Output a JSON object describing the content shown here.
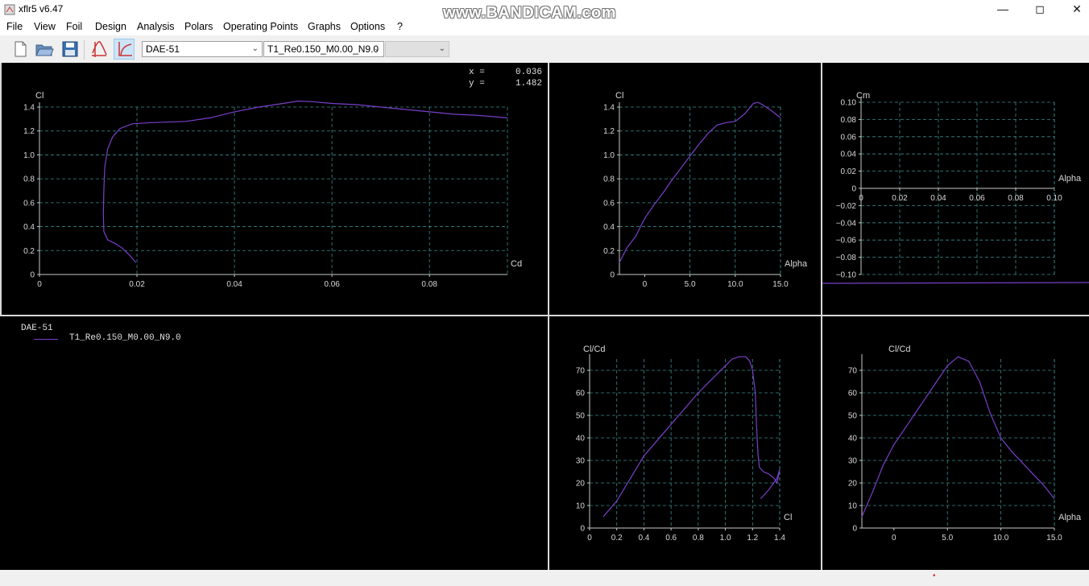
{
  "window": {
    "title": "xflr5 v6.47",
    "watermark": "www.BANDICAM.com"
  },
  "menu": [
    "File",
    "View",
    "Foil",
    "Design",
    "Analysis",
    "Polars",
    "Operating Points",
    "Graphs",
    "Options",
    "?"
  ],
  "toolbar": {
    "foil_select": "DAE-51",
    "polar_select": "T1_Re0.150_M0.00_N9.0",
    "opp_select": ""
  },
  "colors": {
    "curve": "#7a3fc9",
    "grid": "#3c8c8c",
    "axis": "#c8c8c8",
    "text": "#d8d8d8",
    "background": "#000000"
  },
  "cursor_readout": {
    "x_label": "x =",
    "x_value": "0.036",
    "y_label": "y =",
    "y_value": "1.482"
  },
  "legend": {
    "foil": "DAE-51",
    "polar": "T1_Re0.150_M0.00_N9.0"
  },
  "chart_data": [
    {
      "type": "line",
      "xlabel": "Cd",
      "ylabel": "Cl",
      "xlim": [
        0,
        0.096
      ],
      "ylim": [
        0,
        1.4
      ],
      "xticks": [
        "0",
        "0.02",
        "0.04",
        "0.06",
        "0.08"
      ],
      "yticks": [
        "0",
        "0.2",
        "0.4",
        "0.6",
        "0.8",
        "1.0",
        "1.2",
        "1.4"
      ],
      "grid": true,
      "series": [
        {
          "x": [
            0.0198,
            0.0185,
            0.017,
            0.0155,
            0.014,
            0.0132,
            0.0131,
            0.0132,
            0.0134,
            0.014,
            0.015,
            0.0165,
            0.019,
            0.023,
            0.03,
            0.035,
            0.04,
            0.045,
            0.05,
            0.053,
            0.056,
            0.06,
            0.065,
            0.07,
            0.075,
            0.08,
            0.085,
            0.09,
            0.096
          ],
          "y": [
            0.1,
            0.16,
            0.22,
            0.26,
            0.29,
            0.36,
            0.5,
            0.7,
            0.9,
            1.05,
            1.15,
            1.22,
            1.26,
            1.27,
            1.28,
            1.31,
            1.36,
            1.4,
            1.43,
            1.45,
            1.445,
            1.43,
            1.42,
            1.4,
            1.38,
            1.36,
            1.34,
            1.33,
            1.31
          ]
        }
      ]
    },
    {
      "type": "line",
      "xlabel": "Alpha",
      "ylabel": "Cl",
      "xlim": [
        -2.8,
        15
      ],
      "ylim": [
        0,
        1.4
      ],
      "xticks": [
        "0",
        "5.0",
        "10.0",
        "15.0"
      ],
      "yticks": [
        "0",
        "0.2",
        "0.4",
        "0.6",
        "0.8",
        "1.0",
        "1.2",
        "1.4"
      ],
      "grid": true,
      "series": [
        {
          "x": [
            -2.8,
            -2.0,
            -1.0,
            0,
            1,
            2,
            3,
            4,
            5,
            6,
            7,
            8,
            9,
            10,
            11,
            12,
            12.5,
            13,
            14,
            15
          ],
          "y": [
            0.1,
            0.22,
            0.32,
            0.47,
            0.58,
            0.68,
            0.79,
            0.89,
            0.99,
            1.09,
            1.18,
            1.25,
            1.27,
            1.28,
            1.34,
            1.43,
            1.44,
            1.42,
            1.37,
            1.31
          ]
        }
      ]
    },
    {
      "type": "line",
      "xlabel": "Alpha",
      "ylabel": "Cm",
      "xlim": [
        0,
        0.1
      ],
      "ylim": [
        -0.1,
        0.1
      ],
      "xticks": [
        "0",
        "0.02",
        "0.04",
        "0.06",
        "0.08",
        "0.10"
      ],
      "yticks": [
        "−0.10",
        "−0.08",
        "−0.06",
        "−0.04",
        "−0.02",
        "0",
        "0.02",
        "0.04",
        "0.06",
        "0.08",
        "0.10"
      ],
      "grid": true,
      "series": [
        {
          "x": [],
          "y": []
        }
      ]
    },
    {
      "type": "line",
      "xlabel": "Cl",
      "ylabel": "Cl/Cd",
      "xlim": [
        0,
        1.4
      ],
      "ylim": [
        0,
        75
      ],
      "xticks": [
        "0",
        "0.2",
        "0.4",
        "0.6",
        "0.8",
        "1.0",
        "1.2",
        "1.4"
      ],
      "yticks": [
        "0",
        "10",
        "20",
        "30",
        "40",
        "50",
        "60",
        "70"
      ],
      "grid": true,
      "series": [
        {
          "x": [
            0.1,
            0.2,
            0.3,
            0.4,
            0.5,
            0.6,
            0.7,
            0.8,
            0.9,
            1.0,
            1.05,
            1.1,
            1.15,
            1.18,
            1.2,
            1.22,
            1.23,
            1.24,
            1.25,
            1.28,
            1.32,
            1.36,
            1.38,
            1.4,
            1.38,
            1.32,
            1.26
          ],
          "y": [
            5,
            12,
            22,
            32,
            39,
            46,
            53,
            60,
            66,
            72,
            75,
            76,
            76,
            74,
            70,
            60,
            45,
            33,
            27,
            25,
            24,
            22,
            20,
            26,
            22,
            17,
            13
          ]
        }
      ]
    },
    {
      "type": "line",
      "xlabel": "Alpha",
      "ylabel": "Cl/Cd",
      "xlim": [
        -3,
        15
      ],
      "ylim": [
        0,
        75
      ],
      "xticks": [
        "0",
        "5.0",
        "10.0",
        "15.0"
      ],
      "yticks": [
        "0",
        "10",
        "20",
        "30",
        "40",
        "50",
        "60",
        "70"
      ],
      "grid": true,
      "series": [
        {
          "x": [
            -3,
            -2,
            -1,
            0,
            1,
            2,
            3,
            4,
            5,
            6,
            7,
            8,
            9,
            10,
            11,
            12,
            13,
            14,
            15
          ],
          "y": [
            5,
            16,
            28,
            37,
            44,
            51,
            58,
            65,
            72,
            76,
            74,
            65,
            51,
            40,
            34,
            29,
            24,
            19,
            13
          ]
        }
      ]
    }
  ]
}
